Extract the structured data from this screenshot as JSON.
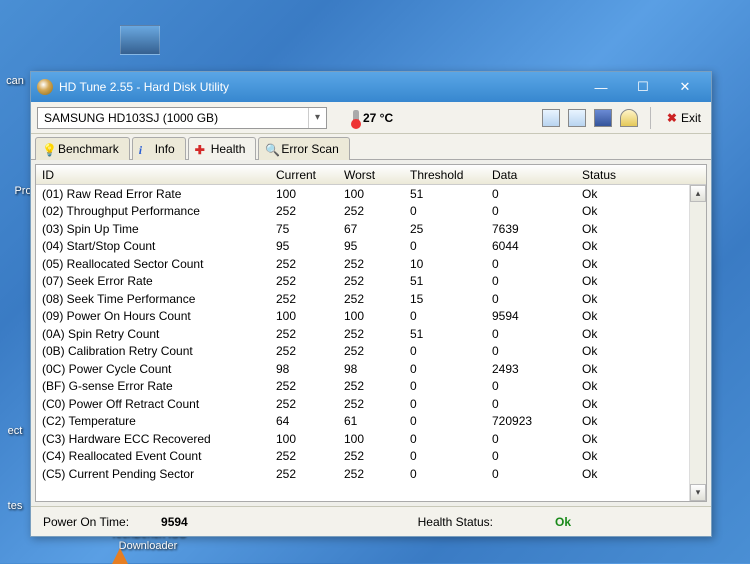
{
  "desktop": {
    "label_can": "can",
    "label_pro": "Pro",
    "label_ect": "ect",
    "label_tes": "tes",
    "tb_label": "TechBench ISO\nDownloader"
  },
  "window": {
    "title": "HD Tune 2.55 - Hard Disk Utility",
    "drive": "SAMSUNG HD103SJ (1000 GB)",
    "temperature": "27 °C",
    "exit_label": "Exit"
  },
  "tabs": {
    "benchmark": "Benchmark",
    "info": "Info",
    "health": "Health",
    "error_scan": "Error Scan"
  },
  "columns": {
    "id": "ID",
    "current": "Current",
    "worst": "Worst",
    "threshold": "Threshold",
    "data": "Data",
    "status": "Status"
  },
  "rows": [
    {
      "id": "(01) Raw Read Error Rate",
      "current": "100",
      "worst": "100",
      "threshold": "51",
      "data": "0",
      "status": "Ok"
    },
    {
      "id": "(02) Throughput Performance",
      "current": "252",
      "worst": "252",
      "threshold": "0",
      "data": "0",
      "status": "Ok"
    },
    {
      "id": "(03) Spin Up Time",
      "current": "75",
      "worst": "67",
      "threshold": "25",
      "data": "7639",
      "status": "Ok"
    },
    {
      "id": "(04) Start/Stop Count",
      "current": "95",
      "worst": "95",
      "threshold": "0",
      "data": "6044",
      "status": "Ok"
    },
    {
      "id": "(05) Reallocated Sector Count",
      "current": "252",
      "worst": "252",
      "threshold": "10",
      "data": "0",
      "status": "Ok"
    },
    {
      "id": "(07) Seek Error Rate",
      "current": "252",
      "worst": "252",
      "threshold": "51",
      "data": "0",
      "status": "Ok"
    },
    {
      "id": "(08) Seek Time Performance",
      "current": "252",
      "worst": "252",
      "threshold": "15",
      "data": "0",
      "status": "Ok"
    },
    {
      "id": "(09) Power On Hours Count",
      "current": "100",
      "worst": "100",
      "threshold": "0",
      "data": "9594",
      "status": "Ok"
    },
    {
      "id": "(0A) Spin Retry Count",
      "current": "252",
      "worst": "252",
      "threshold": "51",
      "data": "0",
      "status": "Ok"
    },
    {
      "id": "(0B) Calibration Retry Count",
      "current": "252",
      "worst": "252",
      "threshold": "0",
      "data": "0",
      "status": "Ok"
    },
    {
      "id": "(0C) Power Cycle Count",
      "current": "98",
      "worst": "98",
      "threshold": "0",
      "data": "2493",
      "status": "Ok"
    },
    {
      "id": "(BF) G-sense Error Rate",
      "current": "252",
      "worst": "252",
      "threshold": "0",
      "data": "0",
      "status": "Ok"
    },
    {
      "id": "(C0) Power Off Retract Count",
      "current": "252",
      "worst": "252",
      "threshold": "0",
      "data": "0",
      "status": "Ok"
    },
    {
      "id": "(C2) Temperature",
      "current": "64",
      "worst": "61",
      "threshold": "0",
      "data": "720923",
      "status": "Ok"
    },
    {
      "id": "(C3) Hardware ECC Recovered",
      "current": "100",
      "worst": "100",
      "threshold": "0",
      "data": "0",
      "status": "Ok"
    },
    {
      "id": "(C4) Reallocated Event Count",
      "current": "252",
      "worst": "252",
      "threshold": "0",
      "data": "0",
      "status": "Ok"
    },
    {
      "id": "(C5) Current Pending Sector",
      "current": "252",
      "worst": "252",
      "threshold": "0",
      "data": "0",
      "status": "Ok"
    }
  ],
  "footer": {
    "power_on_label": "Power On Time:",
    "power_on_value": "9594",
    "health_label": "Health Status:",
    "health_value": "Ok"
  }
}
